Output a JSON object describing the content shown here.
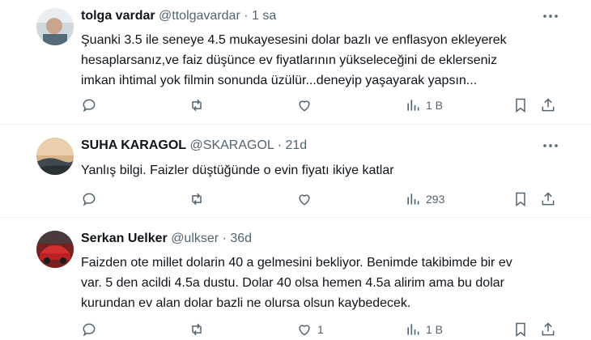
{
  "tweets": [
    {
      "name": "tolga vardar",
      "handle": "@ttolgavardar",
      "separator": "·",
      "time": "1 sa",
      "lines": [
        "Şuanki 3.5 ile seneye 4.5 mukayesesini dolar bazlı ve enflasyon ekleyerek",
        "hesaplarsanız,ve faiz düşünce ev fiyatlarının yükseleceğini de eklerseniz",
        "imkan ihtimal yok filmin sonunda üzülür...deneyip yaşayarak yapsın..."
      ],
      "likes": "",
      "views": "1 B"
    },
    {
      "name": "SUHA KARAGOL",
      "handle": "@SKARAGOL",
      "separator": "·",
      "time": "21d",
      "lines": [
        "Yanlış bilgi. Faizler düştüğünde o evin fiyatı ikiye katlar"
      ],
      "likes": "",
      "views": "293"
    },
    {
      "name": "Serkan Uelker",
      "handle": "@ulkser",
      "separator": "·",
      "time": "36d",
      "lines": [
        "Faizden ote millet dolarin 40 a gelmesini bekliyor. Benimde takibimde bir ev",
        "var. 5 den acildi 4.5a dustu. Dolar 40 olsa hemen 4.5a alirim ama bu dolar",
        "kurundan ev alan dolar bazli ne olursa olsun kaybedecek."
      ],
      "likes": "1",
      "views": "1 B"
    }
  ],
  "icons": {
    "reply": "reply-icon",
    "retweet": "retweet-icon",
    "like": "heart-icon",
    "views": "views-icon",
    "bookmark": "bookmark-icon",
    "share": "share-icon",
    "more": "more-icon"
  },
  "colors": {
    "text": "#0f1419",
    "muted": "#536471",
    "divider": "#eff3f4"
  }
}
